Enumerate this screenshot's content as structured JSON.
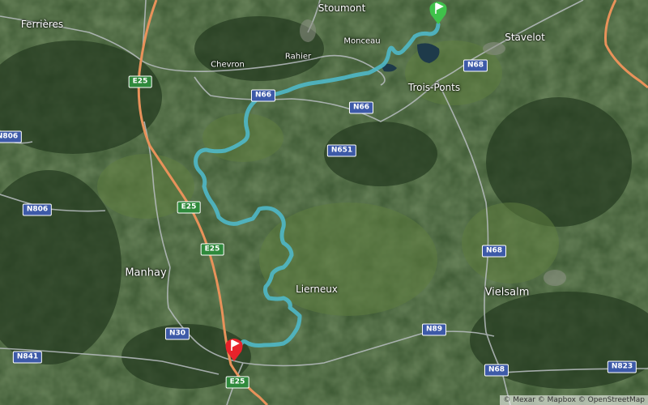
{
  "places": [
    {
      "id": "stoumont",
      "label": "Stoumont"
    },
    {
      "id": "ferrieres",
      "label": "Ferrières"
    },
    {
      "id": "stavelot",
      "label": "Stavelot"
    },
    {
      "id": "monceau",
      "label": "Monceau"
    },
    {
      "id": "chevron",
      "label": "Chevron"
    },
    {
      "id": "rahier",
      "label": "Rahier"
    },
    {
      "id": "trois-ponts",
      "label": "Trois-Ponts"
    },
    {
      "id": "manhay",
      "label": "Manhay"
    },
    {
      "id": "lierneux",
      "label": "Lierneux"
    },
    {
      "id": "vielsalm",
      "label": "Vielsalm"
    }
  ],
  "road_shields": [
    {
      "id": "e25-a",
      "label": "E25",
      "kind": "euro"
    },
    {
      "id": "e25-b",
      "label": "E25",
      "kind": "euro"
    },
    {
      "id": "e25-c",
      "label": "E25",
      "kind": "euro"
    },
    {
      "id": "e25-d",
      "label": "E25",
      "kind": "euro"
    },
    {
      "id": "n66-a",
      "label": "N66",
      "kind": "national"
    },
    {
      "id": "n66-b",
      "label": "N66",
      "kind": "national"
    },
    {
      "id": "n68-a",
      "label": "N68",
      "kind": "national"
    },
    {
      "id": "n68-b",
      "label": "N68",
      "kind": "national"
    },
    {
      "id": "n68-c",
      "label": "N68",
      "kind": "national"
    },
    {
      "id": "n651",
      "label": "N651",
      "kind": "national"
    },
    {
      "id": "n806",
      "label": "N806",
      "kind": "national"
    },
    {
      "id": "n806-edge",
      "label": "N806",
      "kind": "national"
    },
    {
      "id": "n30",
      "label": "N30",
      "kind": "national"
    },
    {
      "id": "n89",
      "label": "N89",
      "kind": "national"
    },
    {
      "id": "n841",
      "label": "N841",
      "kind": "national"
    },
    {
      "id": "n823",
      "label": "N823",
      "kind": "national"
    }
  ],
  "markers": {
    "start": {
      "icon": "green-flag-icon",
      "color": "#3fc24a"
    },
    "end": {
      "icon": "red-flag-icon",
      "color": "#e8232b"
    }
  },
  "route": {
    "color": "#4fb8c8"
  },
  "colors": {
    "motorway": "#e8925a",
    "road": "#b9bec2"
  },
  "attribution": "© Mexar © Mapbox © OpenStreetMap"
}
